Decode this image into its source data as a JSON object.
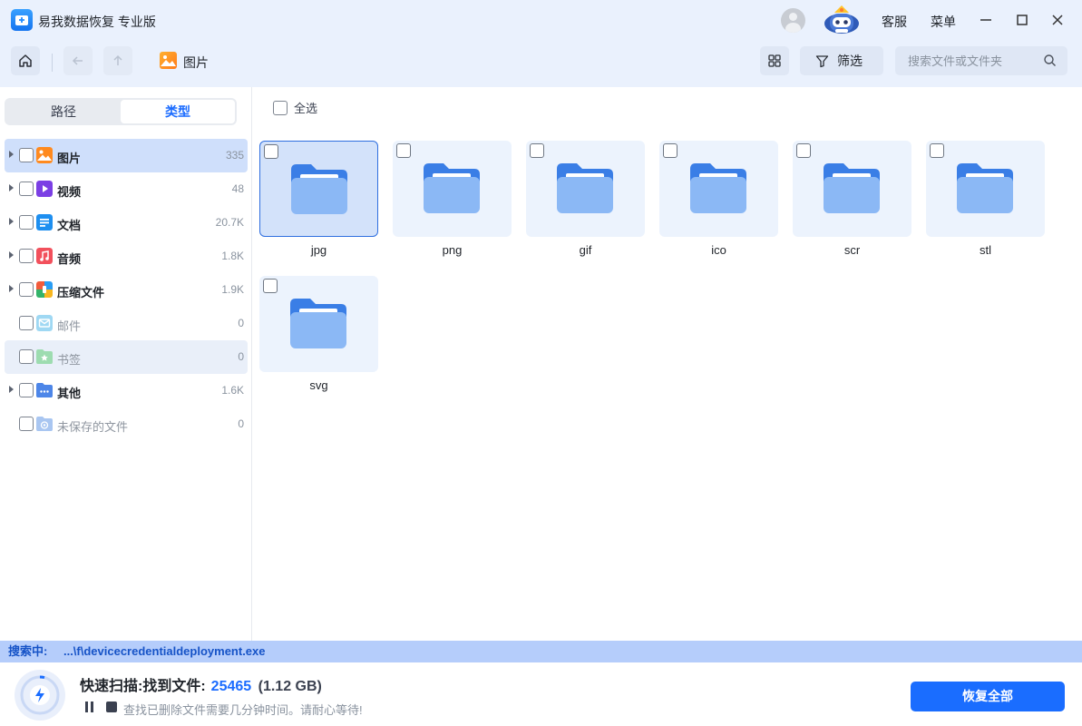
{
  "app": {
    "title": "易我数据恢复 专业版"
  },
  "titlebar": {
    "service_label": "客服",
    "menu_label": "菜单"
  },
  "toolbar": {
    "breadcrumb": "图片",
    "filter_label": "筛选",
    "search_placeholder": "搜索文件或文件夹"
  },
  "sidebar": {
    "tabs": [
      {
        "label": "路径",
        "active": false
      },
      {
        "label": "类型",
        "active": true
      }
    ],
    "categories": [
      {
        "label": "图片",
        "count": "335",
        "icon": "image-icon",
        "expandable": true,
        "enabled": true
      },
      {
        "label": "视频",
        "count": "48",
        "icon": "video-icon",
        "expandable": true,
        "enabled": true
      },
      {
        "label": "文档",
        "count": "20.7K",
        "icon": "document-icon",
        "expandable": true,
        "enabled": true
      },
      {
        "label": "音频",
        "count": "1.8K",
        "icon": "music-icon",
        "expandable": true,
        "enabled": true
      },
      {
        "label": "压缩文件",
        "count": "1.9K",
        "icon": "archive-icon",
        "expandable": true,
        "enabled": true
      },
      {
        "label": "邮件",
        "count": "0",
        "icon": "mail-icon",
        "expandable": false,
        "enabled": false
      },
      {
        "label": "书签",
        "count": "0",
        "icon": "bookmark-icon",
        "expandable": false,
        "enabled": false
      },
      {
        "label": "其他",
        "count": "1.6K",
        "icon": "folder-more-icon",
        "expandable": true,
        "enabled": true
      },
      {
        "label": "未保存的文件",
        "count": "0",
        "icon": "unsaved-file-icon",
        "expandable": false,
        "enabled": false
      }
    ]
  },
  "main": {
    "select_all_label": "全选",
    "folders": [
      {
        "label": "jpg",
        "selected": true
      },
      {
        "label": "png",
        "selected": false
      },
      {
        "label": "gif",
        "selected": false
      },
      {
        "label": "ico",
        "selected": false
      },
      {
        "label": "scr",
        "selected": false
      },
      {
        "label": "stl",
        "selected": false
      },
      {
        "label": "svg",
        "selected": false
      }
    ]
  },
  "status": {
    "searching_label": "搜索中:",
    "searching_path": "...\\f\\devicecredentialdeployment.exe"
  },
  "scan": {
    "title": "快速扫描:找到文件:",
    "found_count": "25465",
    "found_size": "(1.12 GB)",
    "hint": "查找已删除文件需要几分钟时间。请耐心等待!",
    "recover_all_label": "恢复全部"
  },
  "colors": {
    "accent": "#1a6dff",
    "toolbar_bg": "#eaf1fd",
    "folder": "#8bb8f5",
    "folder_tab": "#3a7ee6"
  }
}
